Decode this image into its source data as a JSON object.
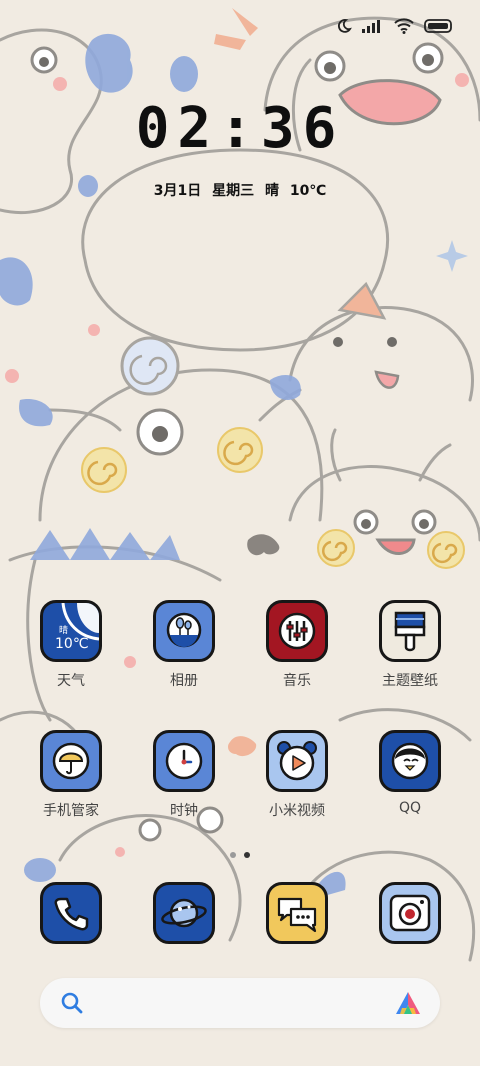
{
  "status_bar": {
    "icons": [
      "moon-icon",
      "signal-icon",
      "wifi-icon",
      "battery-icon"
    ]
  },
  "clock": {
    "time": "02:36",
    "date_line": "3月1日 星期三 晴 10℃"
  },
  "apps": [
    {
      "label": "天气",
      "icon": "weather-icon",
      "widget_top": "晴",
      "widget_temp": "10℃",
      "color": "#1e4fa8"
    },
    {
      "label": "相册",
      "icon": "gallery-icon",
      "color": "#5a86d6"
    },
    {
      "label": "音乐",
      "icon": "music-equalizer-icon",
      "color": "#a31622"
    },
    {
      "label": "主题壁纸",
      "icon": "theme-brush-icon",
      "color": "#efeadf"
    },
    {
      "label": "手机管家",
      "icon": "umbrella-security-icon",
      "color": "#5a86d6"
    },
    {
      "label": "时钟",
      "icon": "clock-icon",
      "color": "#5a86d6"
    },
    {
      "label": "小米视频",
      "icon": "video-panda-icon",
      "color": "#a9c6ef"
    },
    {
      "label": "QQ",
      "icon": "qq-penguin-icon",
      "color": "#1e4fa8"
    }
  ],
  "dock": [
    {
      "icon": "phone-icon",
      "color": "#1e4fa8"
    },
    {
      "icon": "browser-planet-icon",
      "color": "#1e4fa8"
    },
    {
      "icon": "messages-icon",
      "color": "#f1c85c"
    },
    {
      "icon": "camera-icon",
      "color": "#a9c6ef"
    }
  ],
  "page_indicator": {
    "pages": 2,
    "current": 2
  },
  "search_bar": {
    "icons": [
      "search-icon",
      "assistant-icon"
    ]
  },
  "colors": {
    "background": "#f1ebe2",
    "accent_blue": "#1e4fa8",
    "light_blue": "#5a86d6"
  }
}
